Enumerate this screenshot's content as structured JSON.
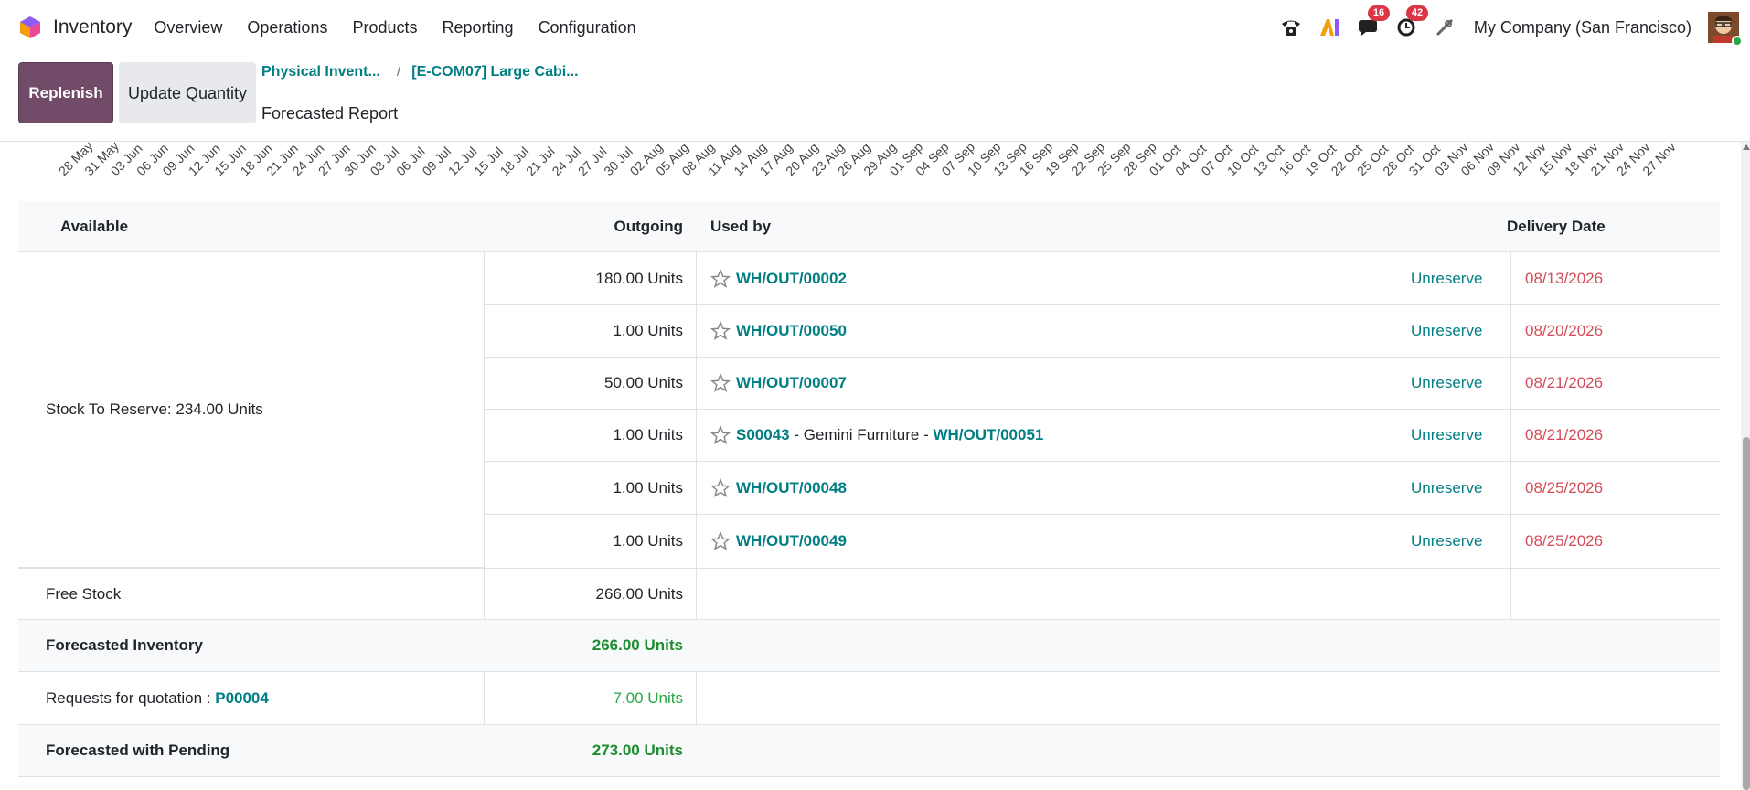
{
  "navbar": {
    "app_name": "Inventory",
    "menu": [
      "Overview",
      "Operations",
      "Products",
      "Reporting",
      "Configuration"
    ],
    "messages_badge": "16",
    "activities_badge": "42",
    "company": "My Company (San Francisco)"
  },
  "control_panel": {
    "replenish_label": "Replenish",
    "update_quantity_label": "Update Quantity",
    "breadcrumb": [
      "Physical Invent...",
      "[E-COM07] Large Cabi..."
    ],
    "title": "Forecasted Report"
  },
  "chart_axis": {
    "tick_labels": [
      "28 May",
      "31 May",
      "03 Jun",
      "06 Jun",
      "09 Jun",
      "12 Jun",
      "15 Jun",
      "18 Jun",
      "21 Jun",
      "24 Jun",
      "27 Jun",
      "30 Jun",
      "03 Jul",
      "06 Jul",
      "09 Jul",
      "12 Jul",
      "15 Jul",
      "18 Jul",
      "21 Jul",
      "24 Jul",
      "27 Jul",
      "30 Jul",
      "02 Aug",
      "05 Aug",
      "08 Aug",
      "11 Aug",
      "14 Aug",
      "17 Aug",
      "20 Aug",
      "23 Aug",
      "26 Aug",
      "29 Aug",
      "01 Sep",
      "04 Sep",
      "07 Sep",
      "10 Sep",
      "13 Sep",
      "16 Sep",
      "19 Sep",
      "22 Sep",
      "25 Sep",
      "28 Sep",
      "01 Oct",
      "04 Oct",
      "07 Oct",
      "10 Oct",
      "13 Oct",
      "16 Oct",
      "19 Oct",
      "22 Oct",
      "25 Oct",
      "28 Oct",
      "31 Oct",
      "03 Nov",
      "06 Nov",
      "09 Nov",
      "12 Nov",
      "15 Nov",
      "18 Nov",
      "21 Nov",
      "24 Nov",
      "27 Nov"
    ]
  },
  "table": {
    "headers": {
      "available": "Available",
      "outgoing": "Outgoing",
      "used_by": "Used by",
      "delivery_date": "Delivery Date"
    },
    "stock_to_reserve": "Stock To Reserve: 234.00 Units",
    "unreserve_label": "Unreserve",
    "moves": [
      {
        "qty": "180.00 Units",
        "ref": "WH/OUT/00002",
        "date": "08/13/2026"
      },
      {
        "qty": "1.00 Units",
        "ref": "WH/OUT/00050",
        "date": "08/20/2026"
      },
      {
        "qty": "50.00 Units",
        "ref": "WH/OUT/00007",
        "date": "08/21/2026"
      },
      {
        "qty": "1.00 Units",
        "so": "S00043",
        "sep1": " - ",
        "partner": "Gemini Furniture",
        "sep2": " - ",
        "ref": "WH/OUT/00051",
        "date": "08/21/2026"
      },
      {
        "qty": "1.00 Units",
        "ref": "WH/OUT/00048",
        "date": "08/25/2026"
      },
      {
        "qty": "1.00 Units",
        "ref": "WH/OUT/00049",
        "date": "08/25/2026"
      }
    ],
    "free_stock": {
      "label": "Free Stock",
      "qty": "266.00 Units"
    },
    "forecasted_inventory": {
      "label": "Forecasted Inventory",
      "qty": "266.00 Units"
    },
    "rfq": {
      "label": "Requests for quotation : ",
      "ref": "P00004",
      "qty": "7.00 Units"
    },
    "forecasted_pending": {
      "label": "Forecasted with Pending",
      "qty": "273.00 Units"
    }
  }
}
